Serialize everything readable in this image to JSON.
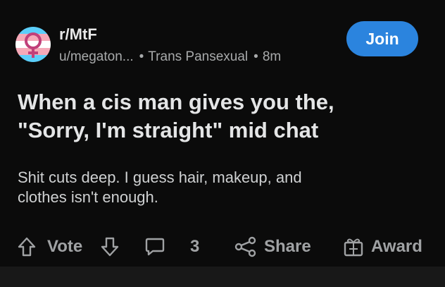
{
  "header": {
    "subreddit": "r/MtF",
    "username": "u/megaton...",
    "flair": "Trans Pansexual",
    "time": "8m",
    "join_label": "Join"
  },
  "post": {
    "title_line1": "When a cis man gives you the,",
    "title_line2": "\"Sorry, I'm straight\" mid chat",
    "body_line1": "Shit cuts deep. I guess hair, makeup, and",
    "body_line2": "clothes isn't enough."
  },
  "actions": {
    "vote_label": "Vote",
    "comment_count": "3",
    "share_label": "Share",
    "award_label": "Award"
  },
  "icons": {
    "avatar": "trans-flag-female-symbol-icon",
    "upvote": "arrow-up-icon",
    "downvote": "arrow-down-icon",
    "comment": "comment-bubble-icon",
    "share": "share-icon",
    "award": "gift-box-icon"
  },
  "colors": {
    "join_button": "#2b84de",
    "trans_blue": "#5bcefa",
    "trans_pink": "#f5a9b8",
    "trans_white": "#ffffff",
    "symbol": "#c0407a"
  }
}
